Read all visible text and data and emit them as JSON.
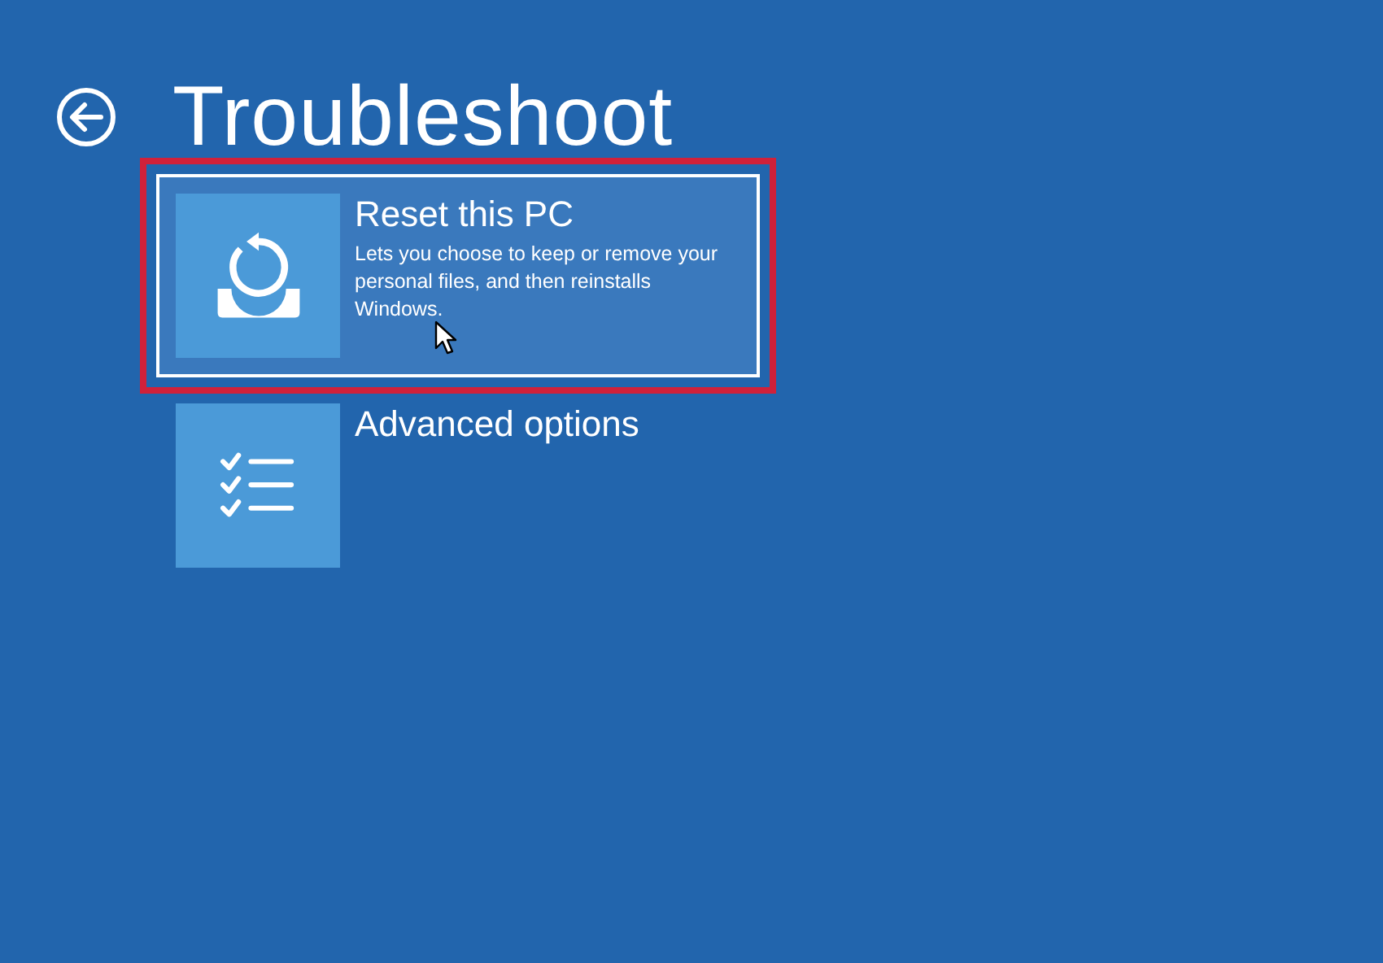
{
  "header": {
    "title": "Troubleshoot"
  },
  "options": [
    {
      "kind": "reset",
      "title": "Reset this PC",
      "description": "Lets you choose to keep or remove your personal files, and then reinstalls Windows.",
      "selected": true,
      "highlighted": true
    },
    {
      "kind": "advanced",
      "title": "Advanced options",
      "selected": false,
      "highlighted": false
    }
  ]
}
